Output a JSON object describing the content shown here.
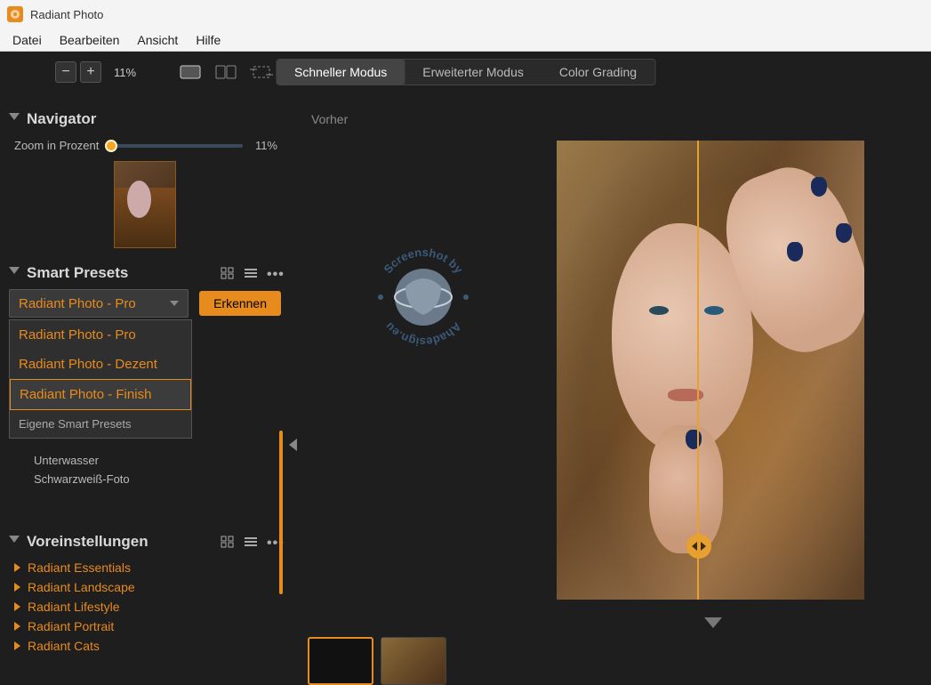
{
  "app": {
    "title": "Radiant Photo"
  },
  "menu": {
    "file": "Datei",
    "edit": "Bearbeiten",
    "view": "Ansicht",
    "help": "Hilfe"
  },
  "toolbar": {
    "zoom_percent": "11%"
  },
  "modes": {
    "quick": "Schneller Modus",
    "extended": "Erweiterter Modus",
    "grading": "Color Grading"
  },
  "navigator": {
    "title": "Navigator",
    "zoom_label": "Zoom in Prozent",
    "zoom_value": "11%"
  },
  "smart_presets": {
    "title": "Smart Presets",
    "selected": "Radiant Photo - Pro",
    "detect_label": "Erkennen",
    "options": [
      "Radiant Photo - Pro",
      "Radiant Photo - Dezent",
      "Radiant Photo - Finish"
    ],
    "own_label": "Eigene Smart Presets",
    "scene_list": [
      "Unterwasser",
      "Schwarzweiß-Foto"
    ]
  },
  "presets_panel": {
    "title": "Voreinstellungen",
    "categories": [
      "Radiant Essentials",
      "Radiant Landscape",
      "Radiant Lifestyle",
      "Radiant Portrait",
      "Radiant Cats"
    ]
  },
  "viewer": {
    "before_label": "Vorher"
  },
  "watermark": {
    "line1": "Screenshot by",
    "line2": "Ahadesign.eu"
  }
}
